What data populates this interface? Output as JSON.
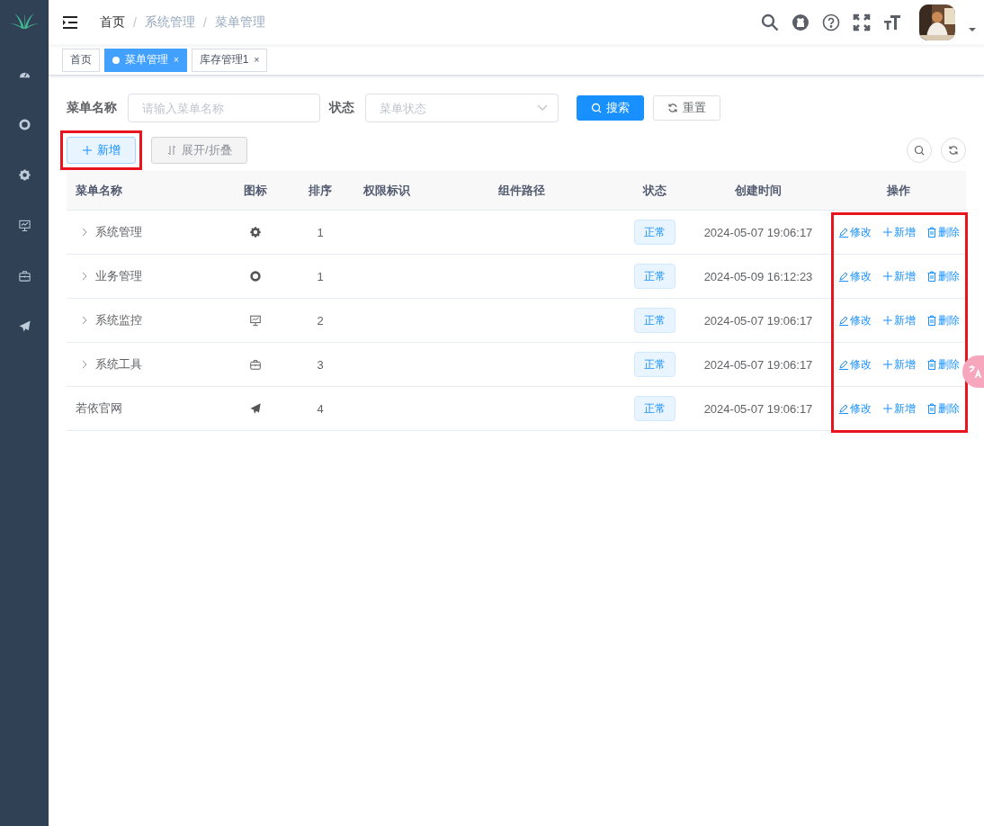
{
  "sidebar": {
    "items": [
      {
        "kind": "dashboard"
      },
      {
        "kind": "target"
      },
      {
        "kind": "gear"
      },
      {
        "kind": "monitor"
      },
      {
        "kind": "toolbox"
      },
      {
        "kind": "send"
      }
    ]
  },
  "breadcrumb": {
    "separator": "/",
    "items": [
      "首页",
      "系统管理",
      "菜单管理"
    ]
  },
  "tags": [
    {
      "label": "首页",
      "selected": false
    },
    {
      "label": "菜单管理",
      "selected": true,
      "close": "×"
    },
    {
      "label": "库存管理1",
      "selected": false,
      "close": "×"
    }
  ],
  "search": {
    "fields": [
      {
        "label": "菜单名称",
        "placeholder": "请输入菜单名称",
        "kind": "input"
      },
      {
        "label": "状态",
        "placeholder": "菜单状态",
        "kind": "select"
      }
    ],
    "buttons": [
      {
        "label": "搜索",
        "kind": "primary"
      },
      {
        "label": "重置",
        "kind": "default"
      }
    ]
  },
  "toolbar": {
    "buttons": [
      {
        "label": "新增",
        "kind": "add",
        "highlighted": true
      },
      {
        "label": "展开/折叠",
        "kind": "expand",
        "highlighted": false
      }
    ]
  },
  "table": {
    "columns": [
      "菜单名称",
      "图标",
      "排序",
      "权限标识",
      "组件路径",
      "状态",
      "创建时间",
      "操作"
    ],
    "actions_highlighted": true,
    "rows": [
      {
        "name": "系统管理",
        "expandable": true,
        "kind": "gear",
        "sort": "1",
        "status": "正常",
        "created": "2024-05-07 19:06:17",
        "actions": [
          {
            "label": "修改",
            "kind": "edit"
          },
          {
            "label": "新增",
            "kind": "add"
          },
          {
            "label": "删除",
            "kind": "delete"
          }
        ]
      },
      {
        "name": "业务管理",
        "expandable": true,
        "kind": "target",
        "sort": "1",
        "status": "正常",
        "created": "2024-05-09 16:12:23",
        "actions": [
          {
            "label": "修改",
            "kind": "edit"
          },
          {
            "label": "新增",
            "kind": "add"
          },
          {
            "label": "删除",
            "kind": "delete"
          }
        ]
      },
      {
        "name": "系统监控",
        "expandable": true,
        "kind": "monitor",
        "sort": "2",
        "status": "正常",
        "created": "2024-05-07 19:06:17",
        "actions": [
          {
            "label": "修改",
            "kind": "edit"
          },
          {
            "label": "新增",
            "kind": "add"
          },
          {
            "label": "删除",
            "kind": "delete"
          }
        ]
      },
      {
        "name": "系统工具",
        "expandable": true,
        "kind": "toolbox",
        "sort": "3",
        "status": "正常",
        "created": "2024-05-07 19:06:17",
        "actions": [
          {
            "label": "修改",
            "kind": "edit"
          },
          {
            "label": "新增",
            "kind": "add"
          },
          {
            "label": "删除",
            "kind": "delete"
          }
        ]
      },
      {
        "name": "若依官网",
        "expandable": false,
        "kind": "send",
        "sort": "4",
        "status": "正常",
        "created": "2024-05-07 19:06:17",
        "actions": [
          {
            "label": "修改",
            "kind": "edit"
          },
          {
            "label": "新增",
            "kind": "add"
          },
          {
            "label": "删除",
            "kind": "delete"
          }
        ]
      }
    ]
  }
}
